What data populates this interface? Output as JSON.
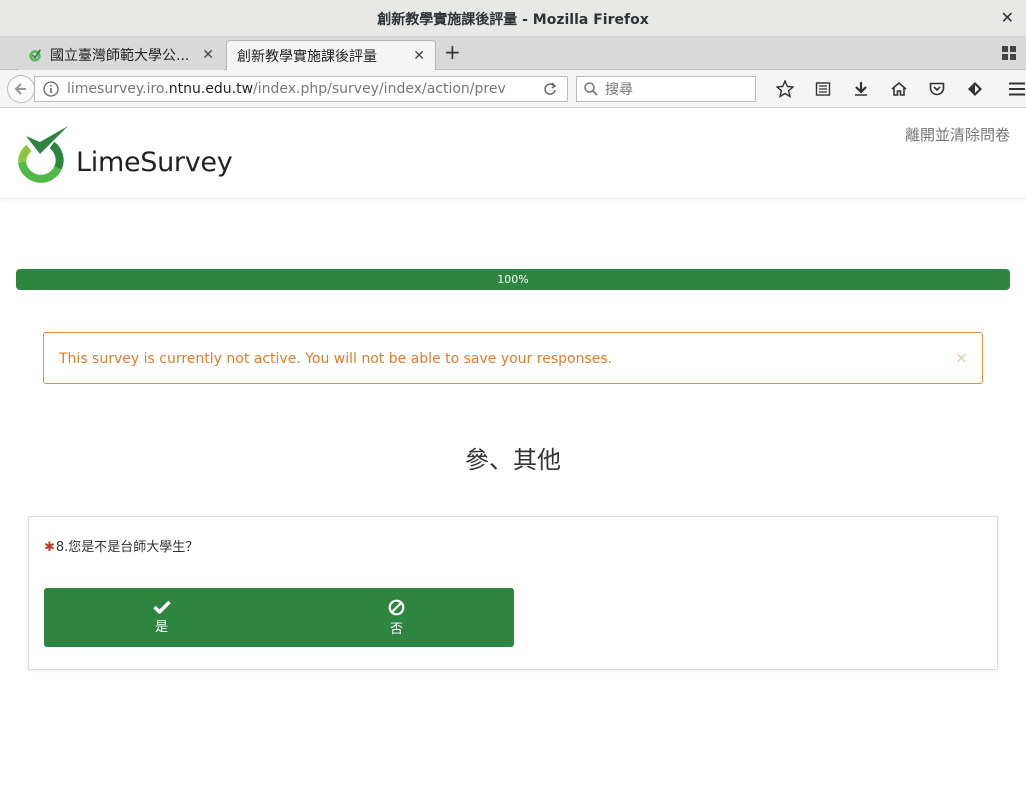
{
  "window": {
    "title": "創新教學實施課後評量 - Mozilla Firefox"
  },
  "tabs": [
    {
      "label": "國立臺灣師範大學公..."
    },
    {
      "label": "創新教學實施課後評量"
    }
  ],
  "navbar": {
    "url_host": "limesurvey.iro.",
    "url_domain": "ntnu.edu.tw",
    "url_path": "/index.php/survey/index/action/previewque",
    "search_placeholder": "搜尋"
  },
  "page": {
    "logo_text": "LimeSurvey",
    "exit_link": "離開並清除問卷",
    "progress": {
      "label": "100%",
      "value": 100
    },
    "alert": "This survey is currently not active. You will not be able to save your responses.",
    "alert_close": "×",
    "group_title": "參、其他",
    "question": {
      "asterisk": "✱",
      "text": "8.您是不是台師大學生？",
      "answers": [
        {
          "label": "是",
          "icon": "check-icon"
        },
        {
          "label": "否",
          "icon": "ban-icon"
        }
      ]
    }
  },
  "colors": {
    "brand_green": "#2e8540",
    "alert_orange": "#e07b2b",
    "required_red": "#c0392b"
  }
}
